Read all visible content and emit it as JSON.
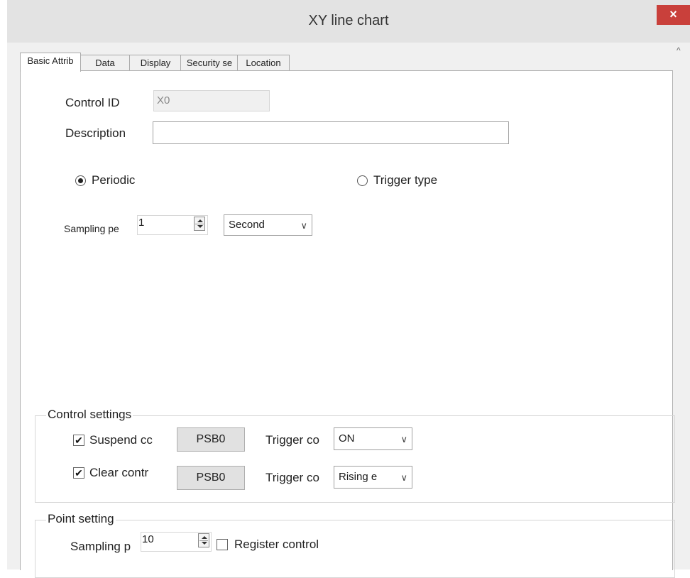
{
  "window": {
    "title": "XY line chart",
    "close_glyph": "×",
    "scroll_glyph": "^"
  },
  "tabs": [
    {
      "label": "Basic Attrib",
      "active": true
    },
    {
      "label": "Data",
      "active": false
    },
    {
      "label": "Display",
      "active": false
    },
    {
      "label": "Security se",
      "active": false
    },
    {
      "label": "Location",
      "active": false
    }
  ],
  "basic": {
    "control_id_label": "Control ID",
    "control_id_value": "X0",
    "description_label": "Description",
    "description_value": "",
    "periodic_label": "Periodic",
    "trigger_type_label": "Trigger type",
    "selected_mode": "Periodic",
    "sampling_period_label": "Sampling pe",
    "sampling_period_value": "1",
    "unit_value": "Second"
  },
  "control_settings": {
    "title": "Control settings",
    "rows": [
      {
        "checkbox_label": "Suspend cc",
        "checked": true,
        "button": "PSB0",
        "trigger_label": "Trigger co",
        "trigger_value": "ON"
      },
      {
        "checkbox_label": "Clear contr",
        "checked": true,
        "button": "PSB0",
        "trigger_label": "Trigger co",
        "trigger_value": "Rising e"
      }
    ]
  },
  "point_setting": {
    "title": "Point setting",
    "sampling_label": "Sampling p",
    "sampling_value": "10",
    "register_control_label": "Register control",
    "register_control_checked": false
  },
  "icons": {
    "checkmark": "✔",
    "chevron": "∨"
  },
  "colors": {
    "close_button": "#c9403b",
    "titlebar": "#e3e3e3"
  }
}
